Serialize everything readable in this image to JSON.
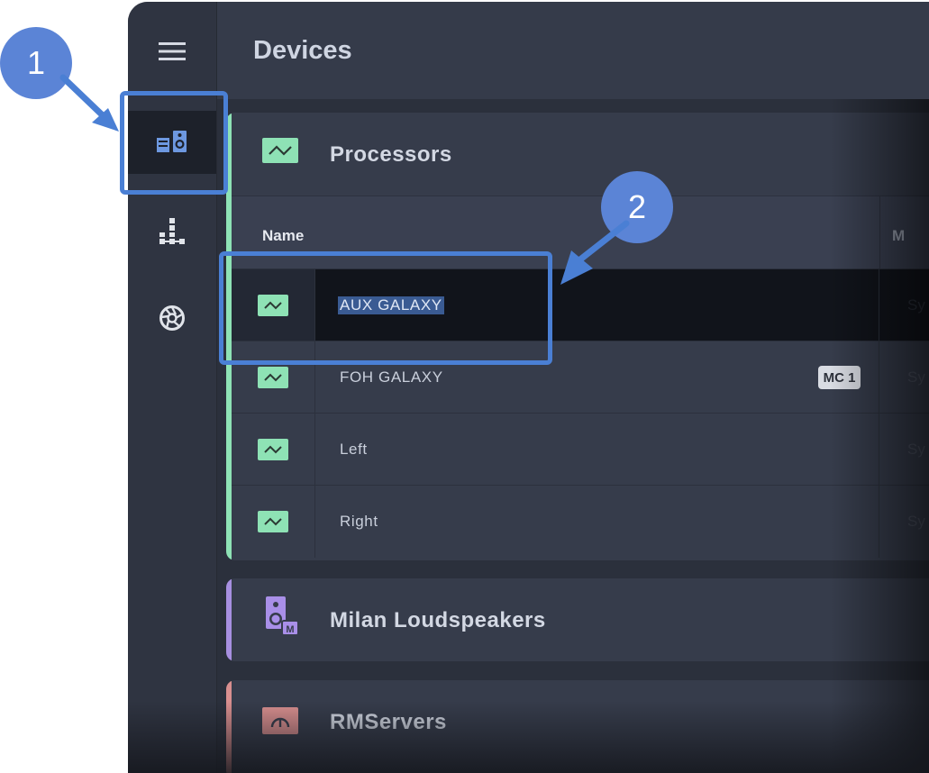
{
  "header": {
    "title": "Devices"
  },
  "rail": {
    "items": [
      {
        "name": "menu",
        "icon": "hamburger-menu-icon"
      },
      {
        "name": "devices",
        "icon": "devices-speaker-icon",
        "active": true
      },
      {
        "name": "network",
        "icon": "network-tree-icon"
      },
      {
        "name": "aperture",
        "icon": "aperture-icon"
      }
    ]
  },
  "groups": {
    "processors": {
      "title": "Processors",
      "accent": "#8ee2b5",
      "columns": {
        "name": "Name",
        "next": "M"
      },
      "rows": [
        {
          "name": "AUX GALAXY",
          "badge": "",
          "next": "Sy",
          "selected": true
        },
        {
          "name": "FOH GALAXY",
          "badge": "MC 1",
          "next": "Sy",
          "selected": false
        },
        {
          "name": "Left",
          "badge": "",
          "next": "Sy",
          "selected": false
        },
        {
          "name": "Right",
          "badge": "",
          "next": "Sy",
          "selected": false
        }
      ]
    },
    "milan": {
      "title": "Milan Loudspeakers",
      "accent": "#a78fe0"
    },
    "rmservers": {
      "title": "RMServers",
      "accent": "#d98f8f"
    }
  },
  "callouts": {
    "one": "1",
    "two": "2"
  },
  "colors": {
    "callout": "#4a7fd4",
    "selection": "#3a5b93"
  }
}
